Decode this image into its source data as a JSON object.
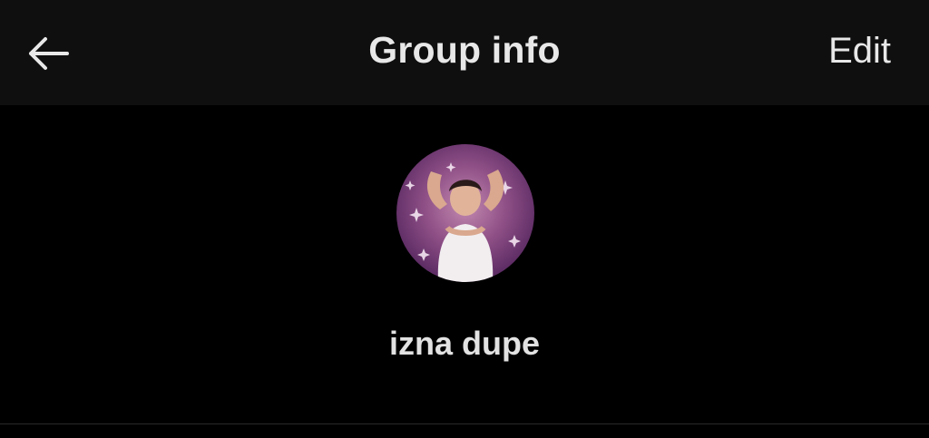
{
  "header": {
    "back_icon": "arrow-left-icon",
    "title": "Group info",
    "edit_label": "Edit"
  },
  "group": {
    "name": "izna dupe",
    "avatar_icon": "group-avatar-photo"
  },
  "colors": {
    "background": "#000000",
    "header_background": "#0f0f0f",
    "text": "#e6e6e6",
    "divider": "#2a2a2a"
  }
}
